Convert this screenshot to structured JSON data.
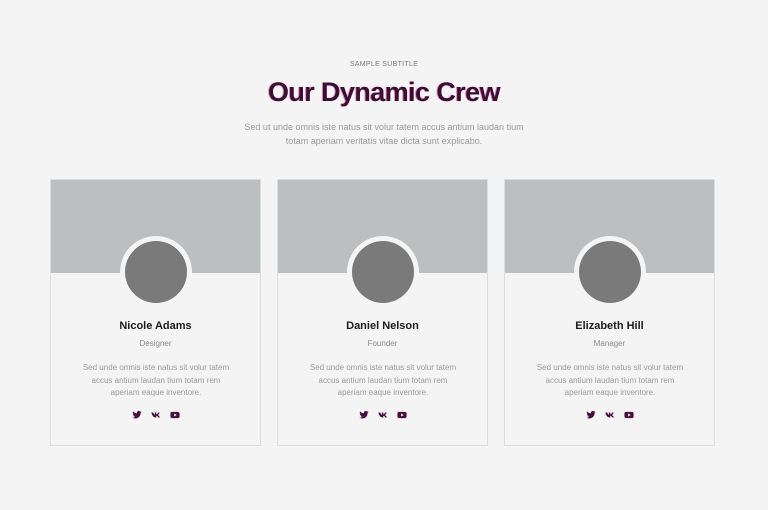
{
  "header": {
    "subtitle": "SAMPLE SUBTITLE",
    "title": "Our Dynamic Crew",
    "lead_line1": "Sed ut unde omnis iste natus sit volur tatem accus antium laudan tium",
    "lead_line2": "totam aperiam veritatis vitae dicta sunt explicabo."
  },
  "colors": {
    "title": "#3b0f33",
    "icon": "#4a0f3c",
    "cover": "#bdbebf",
    "avatar": "#7a7a7b"
  },
  "team": [
    {
      "name": "Nicole Adams",
      "role": "Designer",
      "bio_line1": "Sed unde omnis iste natus sit volur tatem",
      "bio_line2": "accus antium laudan tium totam rem",
      "bio_line3": "aperiam eaque inventore.",
      "socials": [
        "twitter-icon",
        "vk-icon",
        "youtube-icon"
      ]
    },
    {
      "name": "Daniel Nelson",
      "role": "Founder",
      "bio_line1": "Sed unde omnis iste natus sit volur tatem",
      "bio_line2": "accus antium laudan tium totam rem",
      "bio_line3": "aperiam eaque inventore.",
      "socials": [
        "twitter-icon",
        "vk-icon",
        "youtube-icon"
      ]
    },
    {
      "name": "Elizabeth Hill",
      "role": "Manager",
      "bio_line1": "Sed unde omnis iste natus sit volur tatem",
      "bio_line2": "accus antium laudan tium totam rem",
      "bio_line3": "aperiam eaque inventore.",
      "socials": [
        "twitter-icon",
        "vk-icon",
        "youtube-icon"
      ]
    }
  ]
}
